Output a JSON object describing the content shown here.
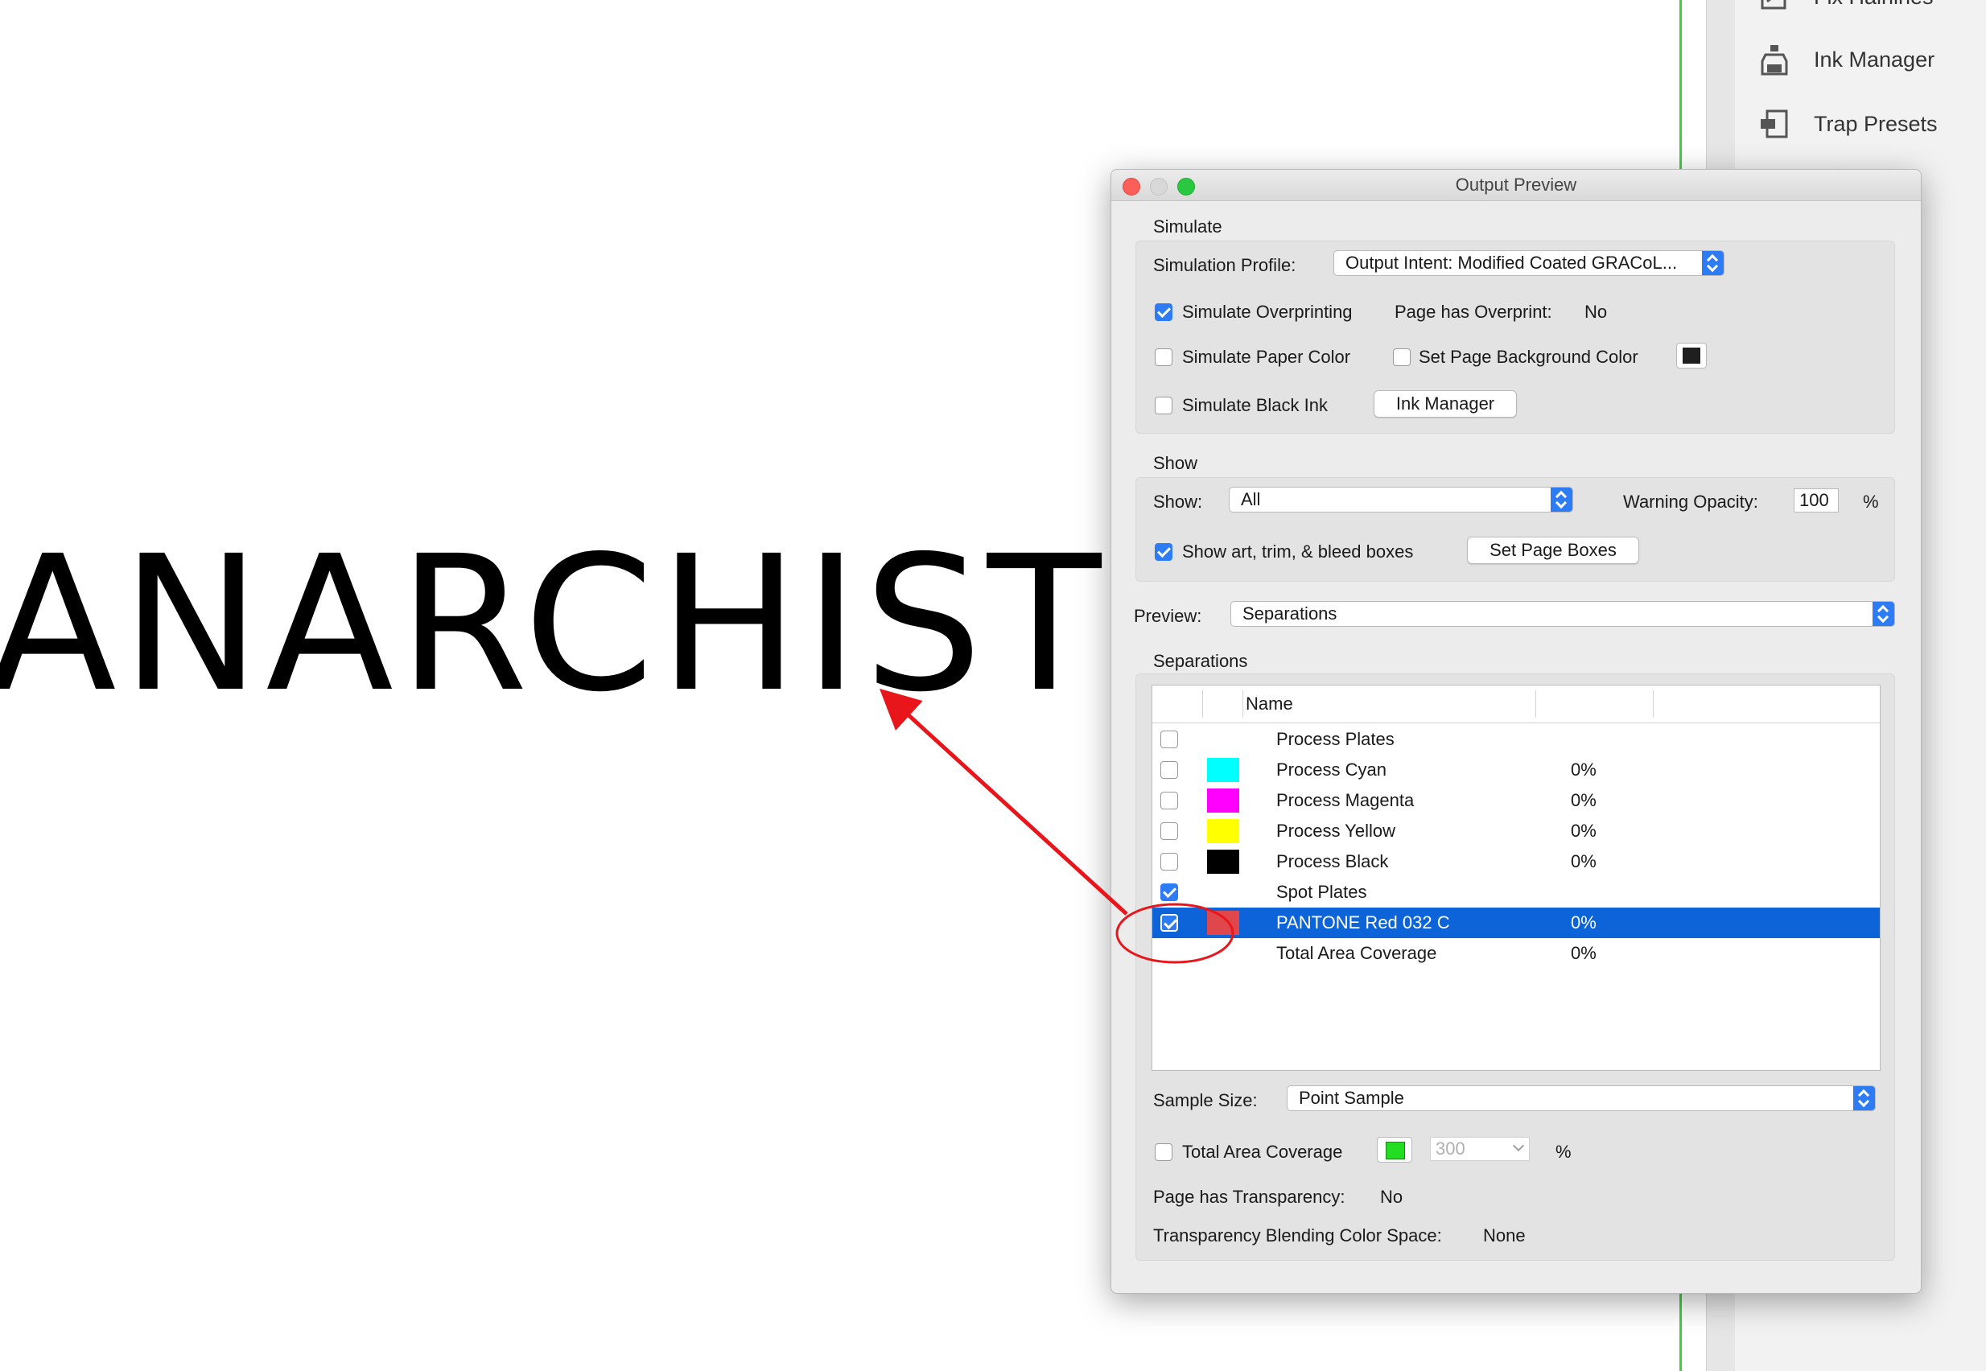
{
  "document": {
    "text": "ANARCHIST"
  },
  "tools_panel": {
    "items": [
      {
        "label": "Fix Hairlines",
        "icon": "fix-hairlines-icon"
      },
      {
        "label": "Ink Manager",
        "icon": "ink-bottle-icon"
      },
      {
        "label": "Trap Presets",
        "icon": "trap-presets-icon"
      }
    ]
  },
  "dialog": {
    "title": "Output Preview",
    "simulate": {
      "section_label": "Simulate",
      "profile_label": "Simulation Profile:",
      "profile_value": "Output Intent: Modified Coated GRACoL...",
      "simulate_overprinting": {
        "label": "Simulate Overprinting",
        "checked": true
      },
      "overprint_label": "Page has Overprint:",
      "overprint_value": "No",
      "simulate_paper_color": {
        "label": "Simulate Paper Color",
        "checked": false
      },
      "set_page_bg": {
        "label": "Set Page Background Color",
        "checked": false,
        "color": "#1f1f1f"
      },
      "simulate_black_ink": {
        "label": "Simulate Black Ink",
        "checked": false
      },
      "ink_manager_button": "Ink Manager"
    },
    "show": {
      "section_label": "Show",
      "show_label": "Show:",
      "show_value": "All",
      "warning_opacity_label": "Warning Opacity:",
      "warning_opacity_value": "100",
      "percent": "%",
      "show_boxes": {
        "label": "Show art, trim, & bleed boxes",
        "checked": true
      },
      "set_page_boxes_button": "Set Page Boxes"
    },
    "preview": {
      "label": "Preview:",
      "value": "Separations"
    },
    "separations": {
      "section_label": "Separations",
      "column_name": "Name",
      "rows": [
        {
          "name": "Process Plates",
          "color": "",
          "pct": "",
          "checked": false,
          "selected": false
        },
        {
          "name": "Process Cyan",
          "color": "#00ffff",
          "pct": "0%",
          "checked": false,
          "selected": false
        },
        {
          "name": "Process Magenta",
          "color": "#ff00ff",
          "pct": "0%",
          "checked": false,
          "selected": false
        },
        {
          "name": "Process Yellow",
          "color": "#ffff00",
          "pct": "0%",
          "checked": false,
          "selected": false
        },
        {
          "name": "Process Black",
          "color": "#000000",
          "pct": "0%",
          "checked": false,
          "selected": false
        },
        {
          "name": "Spot Plates",
          "color": "",
          "pct": "",
          "checked": true,
          "selected": false
        },
        {
          "name": "PANTONE Red 032 C",
          "color": "#e0474c",
          "pct": "0%",
          "checked": true,
          "selected": true
        },
        {
          "name": "Total Area Coverage",
          "color": "",
          "pct": "0%",
          "checked": null,
          "selected": false
        }
      ]
    },
    "sample_size": {
      "label": "Sample Size:",
      "value": "Point Sample"
    },
    "total_area_coverage": {
      "label": "Total Area Coverage",
      "checked": false,
      "color": "#22dd22",
      "value": "300",
      "percent": "%"
    },
    "transparency": {
      "label": "Page has Transparency:",
      "value": "No"
    },
    "blending": {
      "label": "Transparency Blending Color Space:",
      "value": "None"
    }
  },
  "colors": {
    "accent": "#2d7cf6",
    "selection": "#0c64d8",
    "annotation": "#e8161b"
  }
}
